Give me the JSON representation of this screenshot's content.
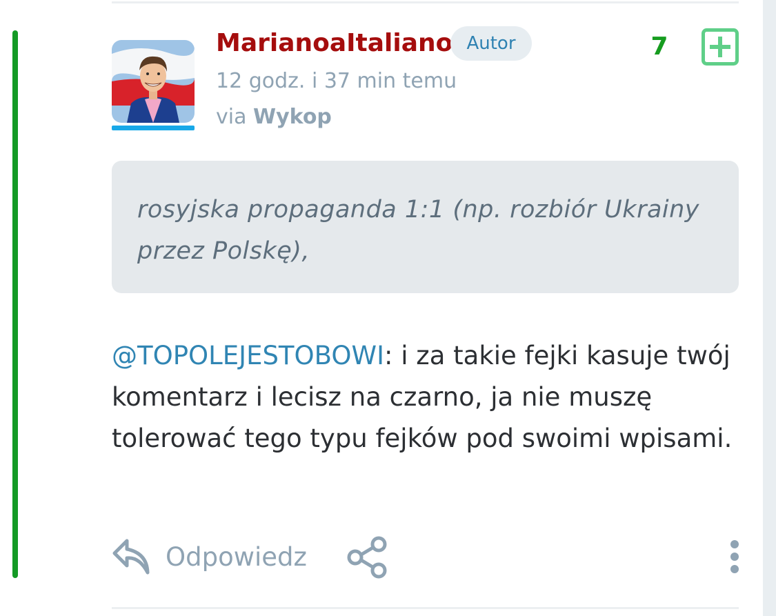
{
  "entry": {
    "author": {
      "username": "MarianoaItaliano",
      "badge": "Autor",
      "avatar_icon": "avatar-icon",
      "username_color": "#a50d0d"
    },
    "timestamp": "12 godz. i 37 min temu",
    "source": {
      "prefix": "via",
      "name": "Wykop"
    },
    "votes": {
      "count": "7",
      "plus_icon": "plus-square-icon",
      "color": "#169c1f"
    },
    "quote": "rosyjska propaganda 1:1 (np. rozbiór Ukrainy przez Polskę),",
    "body": {
      "mention": "@TOPOLEJESTOBOWI",
      "text": ": i za takie fejki kasuje twój komentarz i lecisz na czarno, ja nie muszę tolerować tego typu fejków pod swoimi wpisami."
    },
    "actions": {
      "reply_label": "Odpowiedz",
      "reply_icon": "reply-icon",
      "share_icon": "share-icon",
      "more_icon": "more-vertical-icon"
    },
    "accent_color": "#149a25"
  }
}
